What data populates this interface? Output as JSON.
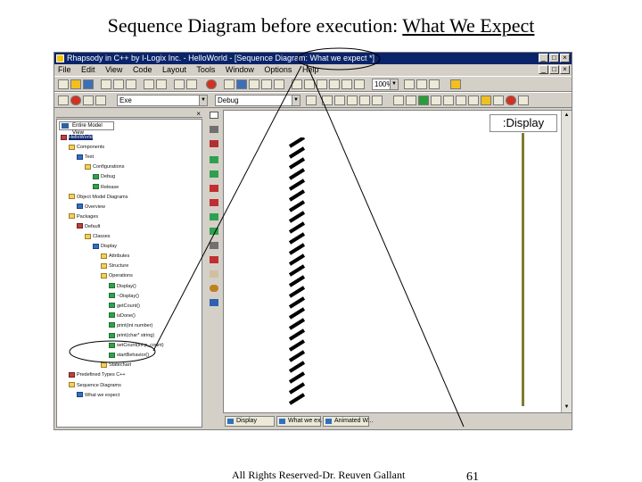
{
  "slide": {
    "title_prefix": "Sequence Diagram before execution: ",
    "title_link": "What We Expect",
    "footer": "All Rights Reserved-Dr. Reuven Gallant",
    "page_number": "61"
  },
  "app": {
    "window_title": "Rhapsody in C++ by I-Logix Inc. - HelloWorld - [Sequence Diagram: What we expect *]",
    "menu": [
      "File",
      "Edit",
      "View",
      "Code",
      "Layout",
      "Tools",
      "Window",
      "Options",
      "Help"
    ],
    "toolbar": {
      "config_combo": "Exe",
      "component_combo": "Debug",
      "zoom_combo": "100%"
    },
    "browser": {
      "view_combo": "Entire Model View",
      "tree": [
        {
          "label": "HelloWorld",
          "icon": "project-icon",
          "level": 0,
          "selected": true
        },
        {
          "label": "Components",
          "icon": "folder-icon",
          "level": 1
        },
        {
          "label": "Test",
          "icon": "component-icon",
          "level": 2
        },
        {
          "label": "Configurations",
          "icon": "folder-icon",
          "level": 3
        },
        {
          "label": "Debug",
          "icon": "configuration-icon",
          "level": 4
        },
        {
          "label": "Release",
          "icon": "configuration-icon",
          "level": 4
        },
        {
          "label": "Object Model Diagrams",
          "icon": "folder-icon",
          "level": 1
        },
        {
          "label": "Overview",
          "icon": "diagram-icon",
          "level": 2
        },
        {
          "label": "Packages",
          "icon": "folder-icon",
          "level": 1
        },
        {
          "label": "Default",
          "icon": "package-icon",
          "level": 2
        },
        {
          "label": "Classes",
          "icon": "folder-icon",
          "level": 3
        },
        {
          "label": "Display",
          "icon": "class-icon",
          "level": 4
        },
        {
          "label": "Attributes",
          "icon": "folder-icon",
          "level": 5
        },
        {
          "label": "Structure",
          "icon": "folder-icon",
          "level": 5
        },
        {
          "label": "Operations",
          "icon": "folder-icon",
          "level": 5
        },
        {
          "label": "Display()",
          "icon": "operation-icon",
          "level": 6
        },
        {
          "label": "~Display()",
          "icon": "operation-icon",
          "level": 6
        },
        {
          "label": "getCount()",
          "icon": "operation-icon",
          "level": 6
        },
        {
          "label": "isDone()",
          "icon": "operation-icon",
          "level": 6
        },
        {
          "label": "print(int number)",
          "icon": "operation-icon",
          "level": 6
        },
        {
          "label": "print(char* string)",
          "icon": "operation-icon",
          "level": 6
        },
        {
          "label": "setCount(int p_count)",
          "icon": "operation-icon",
          "level": 6
        },
        {
          "label": "startBehavior()",
          "icon": "operation-icon",
          "level": 6
        },
        {
          "label": "Statechart",
          "icon": "statechart-icon",
          "level": 5
        },
        {
          "label": "Predefined Types C++",
          "icon": "package-icon",
          "level": 1
        },
        {
          "label": "Sequence Diagrams",
          "icon": "folder-icon",
          "level": 1
        },
        {
          "label": "What we expect",
          "icon": "sequence-diagram-icon",
          "level": 2
        }
      ]
    },
    "diagram": {
      "instance_label": ":Display"
    },
    "tabs": [
      {
        "label": "Display",
        "icon": "statechart-icon"
      },
      {
        "label": "What we ex...",
        "icon": "sequence-diagram-icon"
      },
      {
        "label": "Animated W...",
        "icon": "sequence-diagram-icon"
      }
    ]
  }
}
